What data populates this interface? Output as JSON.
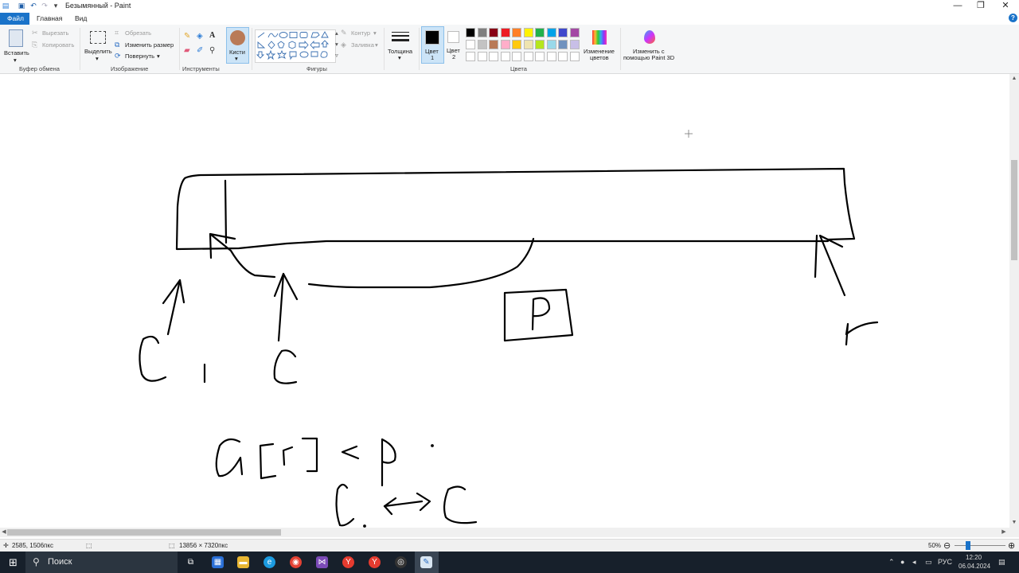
{
  "window": {
    "title": "Безымянный - Paint",
    "controls": {
      "minimize": "—",
      "maximize": "❐",
      "close": "✕"
    }
  },
  "tabs": [
    "Файл",
    "Главная",
    "Вид"
  ],
  "help_label": "?",
  "ribbon": {
    "clipboard": {
      "group": "Буфер обмена",
      "paste": "Вставить",
      "cut": "Вырезать",
      "copy": "Копировать"
    },
    "image": {
      "group": "Изображение",
      "select": "Выделить",
      "crop": "Обрезать",
      "resize": "Изменить размер",
      "rotate": "Повернуть"
    },
    "tools": {
      "group": "Инструменты"
    },
    "brushes": {
      "label": "Кисти"
    },
    "shapes": {
      "group": "Фигуры",
      "outline": "Контур",
      "fill": "Заливка"
    },
    "size": {
      "label": "Толщина"
    },
    "colors": {
      "group": "Цвета",
      "color1": "Цвет",
      "color1_num": "1",
      "color2": "Цвет",
      "color2_num": "2",
      "edit_colors": "Изменение",
      "edit_colors2": "цветов",
      "paint3d": "Изменить с",
      "paint3d2": "помощью Paint 3D",
      "palette_row1": [
        "#000000",
        "#7f7f7f",
        "#880015",
        "#ed1c24",
        "#ff7f27",
        "#fff200",
        "#22b14c",
        "#00a2e8",
        "#3f48cc",
        "#a349a4"
      ],
      "palette_row2": [
        "#ffffff",
        "#c3c3c3",
        "#b97a57",
        "#ffaec9",
        "#ffc90e",
        "#efe4b0",
        "#b5e61d",
        "#99d9ea",
        "#7092be",
        "#c8bfe7"
      ],
      "palette_row3": [
        "#ffffff",
        "#ffffff",
        "#ffffff",
        "#ffffff",
        "#ffffff",
        "#ffffff",
        "#ffffff",
        "#ffffff",
        "#ffffff",
        "#ffffff"
      ]
    }
  },
  "status": {
    "cursor_pos": "2585, 1506пкс",
    "canvas_size": "13856 × 7320пкс",
    "zoom": "50%"
  },
  "taskbar": {
    "search": "Поиск",
    "lang": "РУС",
    "time": "12:20",
    "date": "06.04.2024"
  }
}
